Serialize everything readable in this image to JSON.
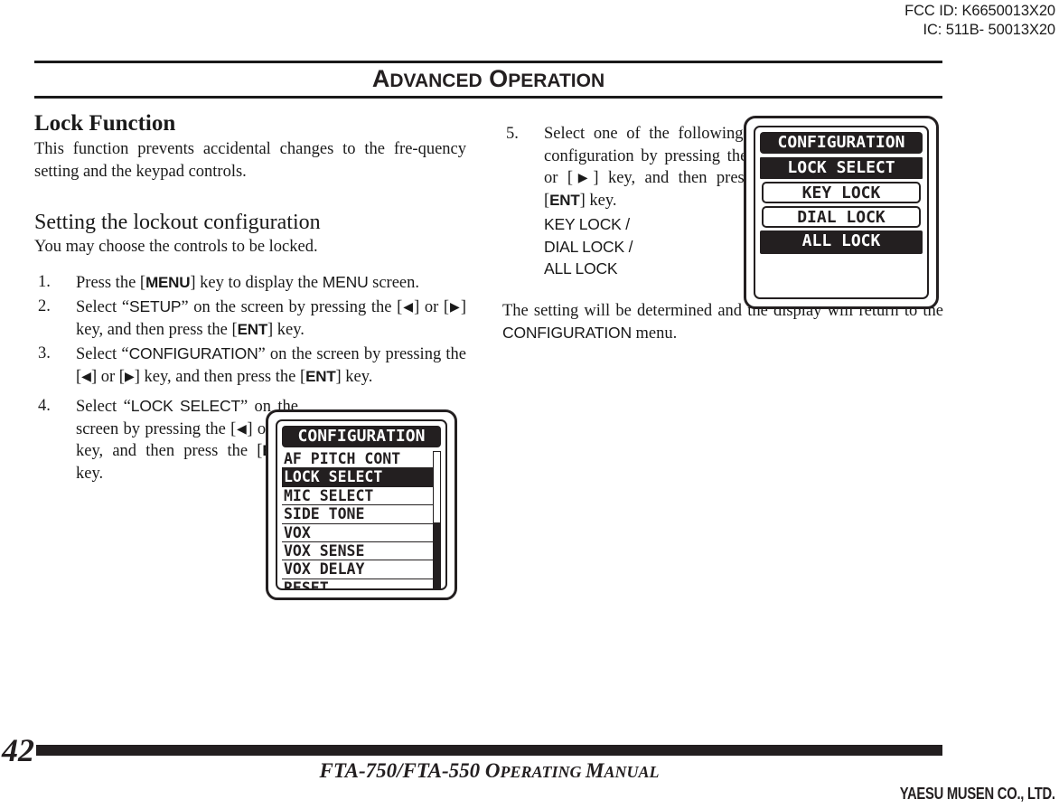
{
  "regulatory": {
    "fcc_id": "FCC ID: K6650013X20",
    "ic_id": "IC: 511B- 50013X20"
  },
  "chapter": {
    "title_first_cap": "A",
    "title_first_rest": "DVANCED",
    "title_second_cap": "O",
    "title_second_rest": "PERATION"
  },
  "left_column": {
    "section_title": "Lock Function",
    "intro": "This function prevents accidental changes to the fre-quency setting and the keypad controls.",
    "subsection_title": "Setting the lockout configuration",
    "subsection_intro": "You may choose the controls to be locked.",
    "steps": [
      {
        "num": "1.",
        "parts": [
          {
            "t": "Press the [",
            "s": "body"
          },
          {
            "t": "MENU",
            "s": "key"
          },
          {
            "t": "] key to display the ",
            "s": "body"
          },
          {
            "t": "MENU",
            "s": "ui"
          },
          {
            "t": " screen.",
            "s": "body"
          }
        ]
      },
      {
        "num": "2.",
        "parts": [
          {
            "t": "Select “",
            "s": "body"
          },
          {
            "t": "SETUP",
            "s": "ui"
          },
          {
            "t": "” on the screen by pressing the [",
            "s": "body"
          },
          {
            "t": "◀",
            "s": "arrow"
          },
          {
            "t": "] or [",
            "s": "body"
          },
          {
            "t": "▶",
            "s": "arrow"
          },
          {
            "t": "] key, and then press the [",
            "s": "body"
          },
          {
            "t": "ENT",
            "s": "key"
          },
          {
            "t": "] key.",
            "s": "body"
          }
        ]
      },
      {
        "num": "3.",
        "parts": [
          {
            "t": "Select “",
            "s": "body"
          },
          {
            "t": "CONFIGURATION",
            "s": "ui"
          },
          {
            "t": "” on the screen by pressing the [",
            "s": "body"
          },
          {
            "t": "◀",
            "s": "arrow"
          },
          {
            "t": "] or [",
            "s": "body"
          },
          {
            "t": "▶",
            "s": "arrow"
          },
          {
            "t": "] key, and then press the [",
            "s": "body"
          },
          {
            "t": "ENT",
            "s": "key"
          },
          {
            "t": "] key.",
            "s": "body"
          }
        ]
      },
      {
        "num": "4.",
        "parts": [
          {
            "t": "Select “",
            "s": "body"
          },
          {
            "t": "LOCK SELECT",
            "s": "ui"
          },
          {
            "t": "” on the screen by pressing the [",
            "s": "body"
          },
          {
            "t": "◀",
            "s": "arrow"
          },
          {
            "t": "] or [",
            "s": "body"
          },
          {
            "t": "▶",
            "s": "arrow"
          },
          {
            "t": "] key, and then press the [",
            "s": "body"
          },
          {
            "t": "ENT",
            "s": "key"
          },
          {
            "t": "] key.",
            "s": "body"
          }
        ]
      }
    ]
  },
  "right_column": {
    "steps": [
      {
        "num": "5.",
        "parts": [
          {
            "t": "Select one of the following lock configuration by pressing the [",
            "s": "body"
          },
          {
            "t": "◀",
            "s": "arrow"
          },
          {
            "t": "] or [",
            "s": "body"
          },
          {
            "t": "▶",
            "s": "arrow"
          },
          {
            "t": "] key, and then press the [",
            "s": "body"
          },
          {
            "t": "ENT",
            "s": "key"
          },
          {
            "t": "] key.",
            "s": "body"
          }
        ]
      }
    ],
    "option_lines": [
      "KEY LOCK /",
      "DIAL LOCK /",
      "ALL LOCK"
    ],
    "closing_parts": [
      {
        "t": "The setting will be determined and the display will return to the ",
        "s": "body"
      },
      {
        "t": "CONFIGURATION",
        "s": "ui"
      },
      {
        "t": " menu.",
        "s": "body"
      }
    ]
  },
  "lcd_config_list": {
    "title": "CONFIGURATION",
    "items": [
      {
        "label": "AF PITCH CONT",
        "selected": false
      },
      {
        "label": "LOCK SELECT",
        "selected": true
      },
      {
        "label": "MIC SELECT",
        "selected": false
      },
      {
        "label": "SIDE TONE",
        "selected": false
      },
      {
        "label": "VOX",
        "selected": false
      },
      {
        "label": "VOX SENSE",
        "selected": false
      },
      {
        "label": "VOX DELAY",
        "selected": false
      },
      {
        "label": "RESET",
        "selected": false
      }
    ],
    "scrollbar_thumb_top_pct": 49
  },
  "lcd_lock_select": {
    "title": "CONFIGURATION",
    "subtitle": "LOCK SELECT",
    "options": [
      {
        "label": "KEY LOCK",
        "selected": false
      },
      {
        "label": "DIAL LOCK",
        "selected": false
      },
      {
        "label": "ALL LOCK",
        "selected": true
      }
    ]
  },
  "footer": {
    "page_number": "42",
    "manual_title_parts": [
      {
        "t": "FTA-750/FTA-550 ",
        "s": "cap"
      },
      {
        "t": "O",
        "s": "cap"
      },
      {
        "t": "PERATING ",
        "s": "sc"
      },
      {
        "t": "M",
        "s": "cap"
      },
      {
        "t": "ANUAL",
        "s": "sc"
      }
    ],
    "brand": "YAESU MUSEN CO., LTD."
  },
  "colors": {
    "ink": "#1a1a1a",
    "rule": "#231f20",
    "paper": "#ffffff"
  }
}
